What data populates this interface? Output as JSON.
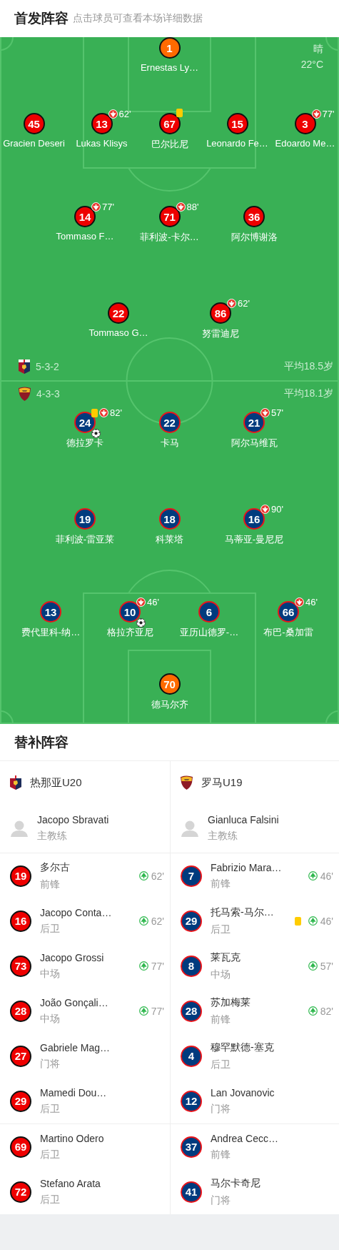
{
  "lineup": {
    "title": "首发阵容",
    "hint": "点击球员可查看本场详细数据"
  },
  "pitch": {
    "weather": "晴",
    "temperature": "22°C",
    "home": {
      "formation": "5-3-2",
      "average_age": "平均18.5岁",
      "lines": [
        [
          {
            "number": "1",
            "name": "Ernestas Ly…",
            "kind": "goalkeeper",
            "yellow_card": false,
            "goal": false
          }
        ],
        [
          {
            "number": "45",
            "name": "Gracien Deseri",
            "kind": "outfield",
            "yellow_card": false,
            "goal": false
          },
          {
            "number": "13",
            "name": "Lukas Klisys",
            "kind": "outfield",
            "yellow_card": false,
            "goal": false,
            "sub_off": "62'"
          },
          {
            "number": "67",
            "name": "巴尔比尼",
            "kind": "outfield",
            "yellow_card": true,
            "goal": false
          },
          {
            "number": "15",
            "name": "Leonardo Fe…",
            "kind": "outfield",
            "yellow_card": false,
            "goal": false
          },
          {
            "number": "3",
            "name": "Edoardo Me…",
            "kind": "outfield",
            "yellow_card": false,
            "goal": false,
            "sub_off": "77'"
          }
        ],
        [
          {
            "number": "14",
            "name": "Tommaso F…",
            "kind": "outfield",
            "yellow_card": false,
            "goal": false,
            "sub_off": "77'"
          },
          {
            "number": "71",
            "name": "菲利波-卡尔…",
            "kind": "outfield",
            "yellow_card": false,
            "goal": false,
            "sub_off": "88'"
          },
          {
            "number": "36",
            "name": "阿尔博谢洛",
            "kind": "outfield",
            "yellow_card": false,
            "goal": false
          }
        ],
        [
          {
            "number": "22",
            "name": "Tommaso G…",
            "kind": "outfield",
            "yellow_card": false,
            "goal": false
          },
          {
            "number": "86",
            "name": "努雷迪尼",
            "kind": "outfield",
            "yellow_card": false,
            "goal": false,
            "sub_off": "62'"
          }
        ]
      ]
    },
    "away": {
      "formation": "4-3-3",
      "average_age": "平均18.1岁",
      "lines": [
        [
          {
            "number": "24",
            "name": "德拉罗卡",
            "kind": "outfield",
            "yellow_card": true,
            "goal": true,
            "sub_off": "82'"
          },
          {
            "number": "22",
            "name": "卡马",
            "kind": "outfield",
            "yellow_card": false,
            "goal": false
          },
          {
            "number": "21",
            "name": "阿尔马维瓦",
            "kind": "outfield",
            "yellow_card": false,
            "goal": false,
            "sub_off": "57'"
          }
        ],
        [
          {
            "number": "19",
            "name": "菲利波-雷亚莱",
            "kind": "outfield",
            "yellow_card": false,
            "goal": false
          },
          {
            "number": "18",
            "name": "科莱塔",
            "kind": "outfield",
            "yellow_card": false,
            "goal": false
          },
          {
            "number": "16",
            "name": "马蒂亚-曼尼尼",
            "kind": "outfield",
            "yellow_card": false,
            "goal": false,
            "sub_off": "90'"
          }
        ],
        [
          {
            "number": "13",
            "name": "费代里科-纳…",
            "kind": "outfield",
            "yellow_card": false,
            "goal": false
          },
          {
            "number": "10",
            "name": "格拉齐亚尼",
            "kind": "outfield",
            "yellow_card": false,
            "goal": true,
            "sub_off": "46'"
          },
          {
            "number": "6",
            "name": "亚历山德罗-…",
            "kind": "outfield",
            "yellow_card": false,
            "goal": false
          },
          {
            "number": "66",
            "name": "布巴-桑加雷",
            "kind": "outfield",
            "yellow_card": false,
            "goal": false,
            "sub_off": "46'"
          }
        ],
        [
          {
            "number": "70",
            "name": "德马尔齐",
            "kind": "goalkeeper",
            "yellow_card": false,
            "goal": false
          }
        ]
      ]
    }
  },
  "substitutes": {
    "title": "替补阵容",
    "teams": [
      {
        "name": "热那亚U20",
        "coach": "Jacopo Sbravati",
        "coach_role": "主教练"
      },
      {
        "name": "罗马U19",
        "coach": "Gianluca Falsini",
        "coach_role": "主教练"
      }
    ],
    "groups": [
      [
        {
          "home": {
            "number": "19",
            "name": "多尔古",
            "position": "前锋",
            "yellow_card": false,
            "sub_on": "62'"
          },
          "away": {
            "number": "7",
            "name": "Fabrizio Mara…",
            "position": "前锋",
            "yellow_card": false,
            "sub_on": "46'"
          }
        },
        {
          "home": {
            "number": "16",
            "name": "Jacopo Conta…",
            "position": "后卫",
            "yellow_card": false,
            "sub_on": "62'"
          },
          "away": {
            "number": "29",
            "name": "托马索-马尔…",
            "position": "后卫",
            "yellow_card": true,
            "sub_on": "46'"
          }
        },
        {
          "home": {
            "number": "73",
            "name": "Jacopo Grossi",
            "position": "中场",
            "yellow_card": false,
            "sub_on": "77'"
          },
          "away": {
            "number": "8",
            "name": "莱瓦克",
            "position": "中场",
            "yellow_card": false,
            "sub_on": "57'"
          }
        },
        {
          "home": {
            "number": "28",
            "name": "João Gonçali…",
            "position": "中场",
            "yellow_card": false,
            "sub_on": "77'"
          },
          "away": {
            "number": "28",
            "name": "苏加梅莱",
            "position": "前锋",
            "yellow_card": false,
            "sub_on": "82'"
          }
        },
        {
          "home": {
            "number": "27",
            "name": "Gabriele Mag…",
            "position": "门将",
            "yellow_card": false
          },
          "away": {
            "number": "4",
            "name": "穆罕默德-塞克",
            "position": "后卫",
            "yellow_card": false
          }
        },
        {
          "home": {
            "number": "29",
            "name": "Mamedi Dou…",
            "position": "后卫",
            "yellow_card": false
          },
          "away": {
            "number": "12",
            "name": "Lan Jovanovic",
            "position": "门将",
            "yellow_card": false
          }
        }
      ],
      [
        {
          "home": {
            "number": "69",
            "name": "Martino Odero",
            "position": "后卫",
            "yellow_card": false
          },
          "away": {
            "number": "37",
            "name": "Andrea Cecc…",
            "position": "前锋",
            "yellow_card": false
          }
        },
        {
          "home": {
            "number": "72",
            "name": "Stefano Arata",
            "position": "后卫",
            "yellow_card": false
          },
          "away": {
            "number": "41",
            "name": "马尔卡奇尼",
            "position": "门将",
            "yellow_card": false
          }
        }
      ]
    ]
  }
}
